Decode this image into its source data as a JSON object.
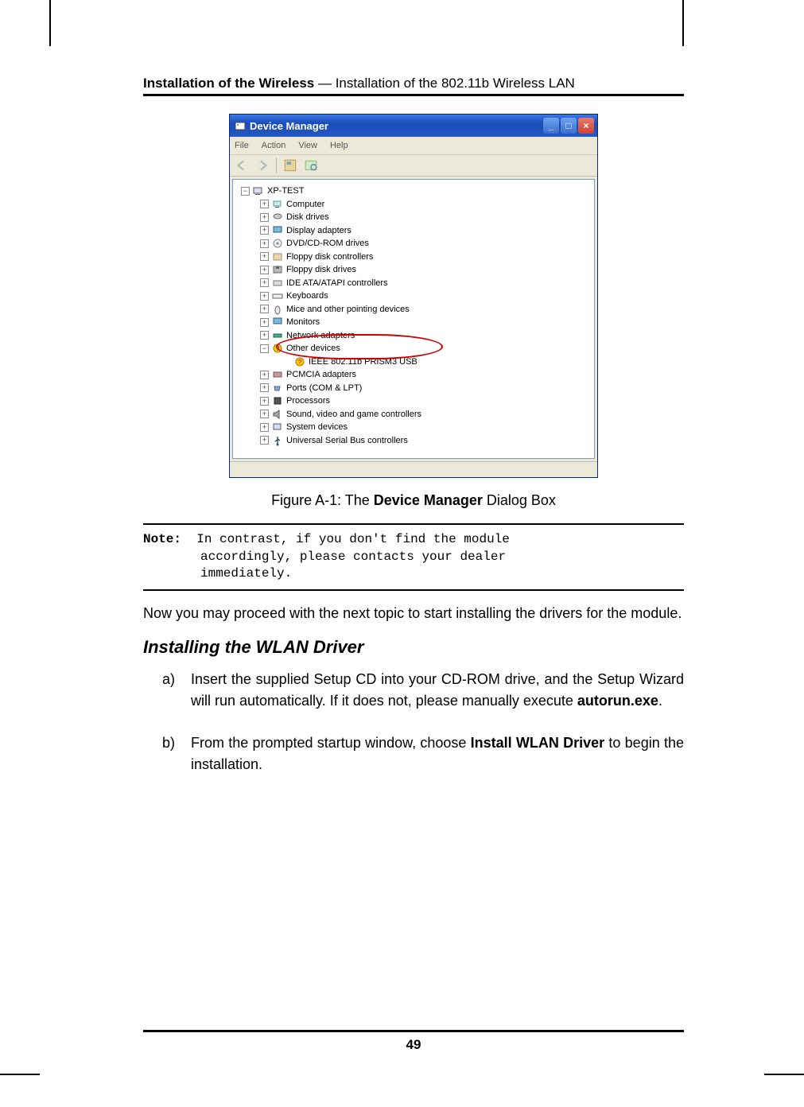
{
  "header": {
    "bold_part": "Installation of the Wireless",
    "sep": " — ",
    "rest": "Installation of the 802.11b Wireless LAN"
  },
  "devmgr": {
    "title": "Device Manager",
    "menu": {
      "file": "File",
      "action": "Action",
      "view": "View",
      "help": "Help"
    },
    "tree": {
      "root": "XP-TEST",
      "computer": "Computer",
      "disk": "Disk drives",
      "display": "Display adapters",
      "dvd": "DVD/CD-ROM drives",
      "floppyctrl": "Floppy disk controllers",
      "floppydrv": "Floppy disk drives",
      "ide": "IDE ATA/ATAPI controllers",
      "keyboards": "Keyboards",
      "mice": "Mice and other pointing devices",
      "monitors": "Monitors",
      "network": "Network adapters",
      "other": "Other devices",
      "other_child": "IEEE 802.11b PRISM3 USB",
      "pcmcia": "PCMCIA adapters",
      "ports": "Ports (COM & LPT)",
      "processors": "Processors",
      "sound": "Sound, video and game controllers",
      "system": "System devices",
      "usb": "Universal Serial Bus controllers"
    }
  },
  "figure": {
    "prefix": "Figure A-1: The ",
    "bold": "Device Manager",
    "suffix": " Dialog Box"
  },
  "note": {
    "label": "Note:",
    "line1": "In contrast, if you don't find the module",
    "line2": "accordingly, please contacts your dealer",
    "line3": "immediately."
  },
  "body1": "Now you may proceed with the next topic to start installing the drivers for the module.",
  "section": "Installing the WLAN Driver",
  "list": {
    "a_letter": "a)",
    "a_text1": "Insert the supplied Setup CD into your CD-ROM drive, and the Setup Wizard will run automatically. If it does not, please manually execute ",
    "a_bold": "autorun.exe",
    "a_text2": ".",
    "b_letter": "b)",
    "b_text1": "From the prompted startup window, choose ",
    "b_bold": "Install WLAN Driver",
    "b_text2": " to begin the installation."
  },
  "page_number": "49"
}
